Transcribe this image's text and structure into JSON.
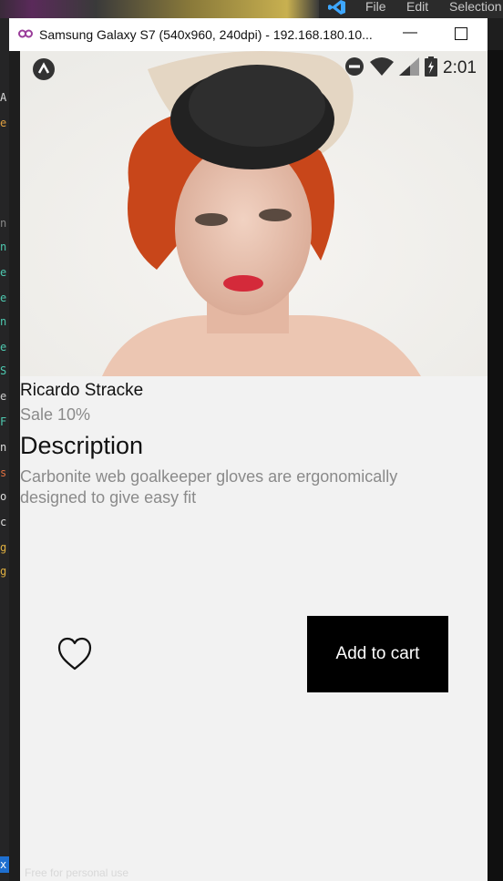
{
  "editor_menu": [
    "File",
    "Edit",
    "Selection"
  ],
  "emulator": {
    "title": "Samsung Galaxy S7 (540x960, 240dpi) - 192.168.180.10...",
    "minimize_glyph": "—"
  },
  "statusbar": {
    "time": "2:01",
    "icons": [
      "app-notification-icon",
      "do-not-disturb-icon",
      "wifi-icon",
      "cell-signal-icon",
      "battery-charging-icon"
    ]
  },
  "product": {
    "name": "Ricardo Stracke",
    "sale": "Sale 10%",
    "description_heading": "Description",
    "description": "Carbonite web goalkeeper gloves are ergonomically designed to give easy fit"
  },
  "actions": {
    "add_to_cart": "Add to cart",
    "favorite_icon": "heart-outline-icon"
  },
  "watermark": "Free for personal use",
  "colors": {
    "screen_bg": "#f2f2f2",
    "button_bg": "#000000",
    "secondary_text": "#8a8a8a"
  }
}
